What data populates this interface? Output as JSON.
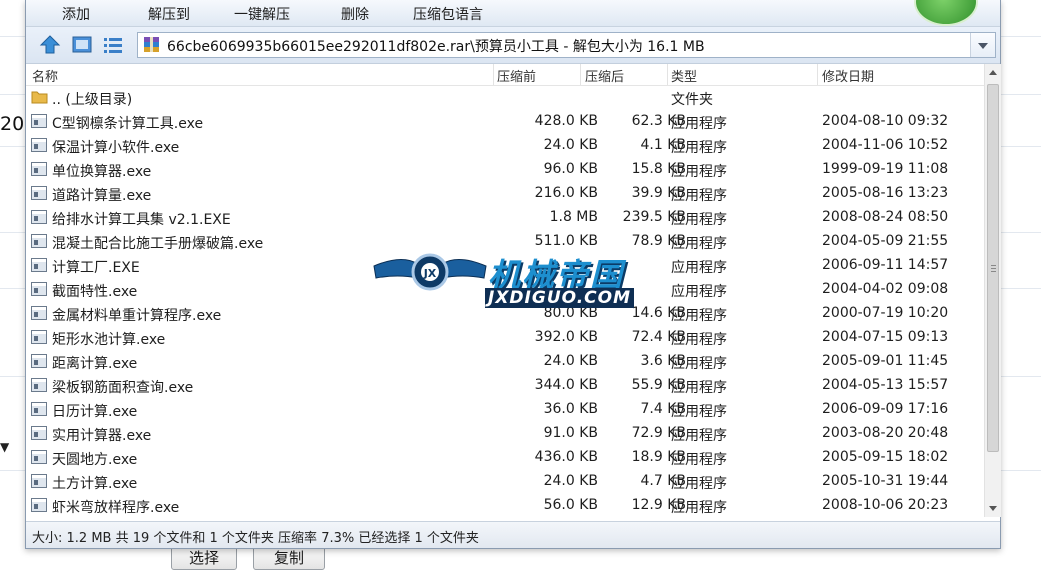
{
  "background": {
    "left_number": "20",
    "left_arrow": "▼",
    "button_select": "选择",
    "button_copy": "复制"
  },
  "toolbar": {
    "items": [
      "添加",
      "解压到",
      "一键解压",
      "删除",
      "压缩包语言"
    ]
  },
  "address": {
    "path": "66cbe6069935b66015ee292011df802e.rar\\预算员小工具 - 解包大小为 16.1 MB"
  },
  "columns": {
    "name": "名称",
    "size": "压缩前",
    "packed": "压缩后",
    "type": "类型",
    "modified": "修改日期"
  },
  "files": [
    {
      "name": ".. (上级目录)",
      "size": "",
      "packed": "",
      "type": "文件夹",
      "date": "",
      "kind": "folder"
    },
    {
      "name": "C型钢檩条计算工具.exe",
      "size": "428.0 KB",
      "packed": "62.3 KB",
      "type": "应用程序",
      "date": "2004-08-10 09:32",
      "kind": "exe"
    },
    {
      "name": "保温计算小软件.exe",
      "size": "24.0 KB",
      "packed": "4.1 KB",
      "type": "应用程序",
      "date": "2004-11-06 10:52",
      "kind": "exe"
    },
    {
      "name": "单位换算器.exe",
      "size": "96.0 KB",
      "packed": "15.8 KB",
      "type": "应用程序",
      "date": "1999-09-19 11:08",
      "kind": "exe"
    },
    {
      "name": "道路计算量.exe",
      "size": "216.0 KB",
      "packed": "39.9 KB",
      "type": "应用程序",
      "date": "2005-08-16 13:23",
      "kind": "exe"
    },
    {
      "name": "给排水计算工具集 v2.1.EXE",
      "size": "1.8 MB",
      "packed": "239.5 KB",
      "type": "应用程序",
      "date": "2008-08-24 08:50",
      "kind": "exe"
    },
    {
      "name": "混凝土配合比施工手册爆破篇.exe",
      "size": "511.0 KB",
      "packed": "78.9 KB",
      "type": "应用程序",
      "date": "2004-05-09 21:55",
      "kind": "exe"
    },
    {
      "name": "计算工厂.EXE",
      "size": "",
      "packed": "",
      "type": "应用程序",
      "date": "2006-09-11 14:57",
      "kind": "exe"
    },
    {
      "name": "截面特性.exe",
      "size": "",
      "packed": "",
      "type": "应用程序",
      "date": "2004-04-02 09:08",
      "kind": "exe"
    },
    {
      "name": "金属材料单重计算程序.exe",
      "size": "80.0 KB",
      "packed": "14.6 KB",
      "type": "应用程序",
      "date": "2000-07-19 10:20",
      "kind": "exe"
    },
    {
      "name": "矩形水池计算.exe",
      "size": "392.0 KB",
      "packed": "72.4 KB",
      "type": "应用程序",
      "date": "2004-07-15 09:13",
      "kind": "exe"
    },
    {
      "name": "距离计算.exe",
      "size": "24.0 KB",
      "packed": "3.6 KB",
      "type": "应用程序",
      "date": "2005-09-01 11:45",
      "kind": "exe"
    },
    {
      "name": "梁板钢筋面积查询.exe",
      "size": "344.0 KB",
      "packed": "55.9 KB",
      "type": "应用程序",
      "date": "2004-05-13 15:57",
      "kind": "exe"
    },
    {
      "name": "日历计算.exe",
      "size": "36.0 KB",
      "packed": "7.4 KB",
      "type": "应用程序",
      "date": "2006-09-09 17:16",
      "kind": "exe"
    },
    {
      "name": "实用计算器.exe",
      "size": "91.0 KB",
      "packed": "72.9 KB",
      "type": "应用程序",
      "date": "2003-08-20 20:48",
      "kind": "exe"
    },
    {
      "name": "天圆地方.exe",
      "size": "436.0 KB",
      "packed": "18.9 KB",
      "type": "应用程序",
      "date": "2005-09-15 18:02",
      "kind": "exe"
    },
    {
      "name": "土方计算.exe",
      "size": "24.0 KB",
      "packed": "4.7 KB",
      "type": "应用程序",
      "date": "2005-10-31 19:44",
      "kind": "exe"
    },
    {
      "name": "虾米弯放样程序.exe",
      "size": "56.0 KB",
      "packed": "12.9 KB",
      "type": "应用程序",
      "date": "2008-10-06 20:23",
      "kind": "exe"
    }
  ],
  "status": {
    "text": "大小: 1.2 MB 共 19 个文件和 1 个文件夹 压缩率 7.3% 已经选择 1 个文件夹"
  },
  "watermark": {
    "title": "机械帝国",
    "subtitle": "JXDIGUO.COM"
  }
}
